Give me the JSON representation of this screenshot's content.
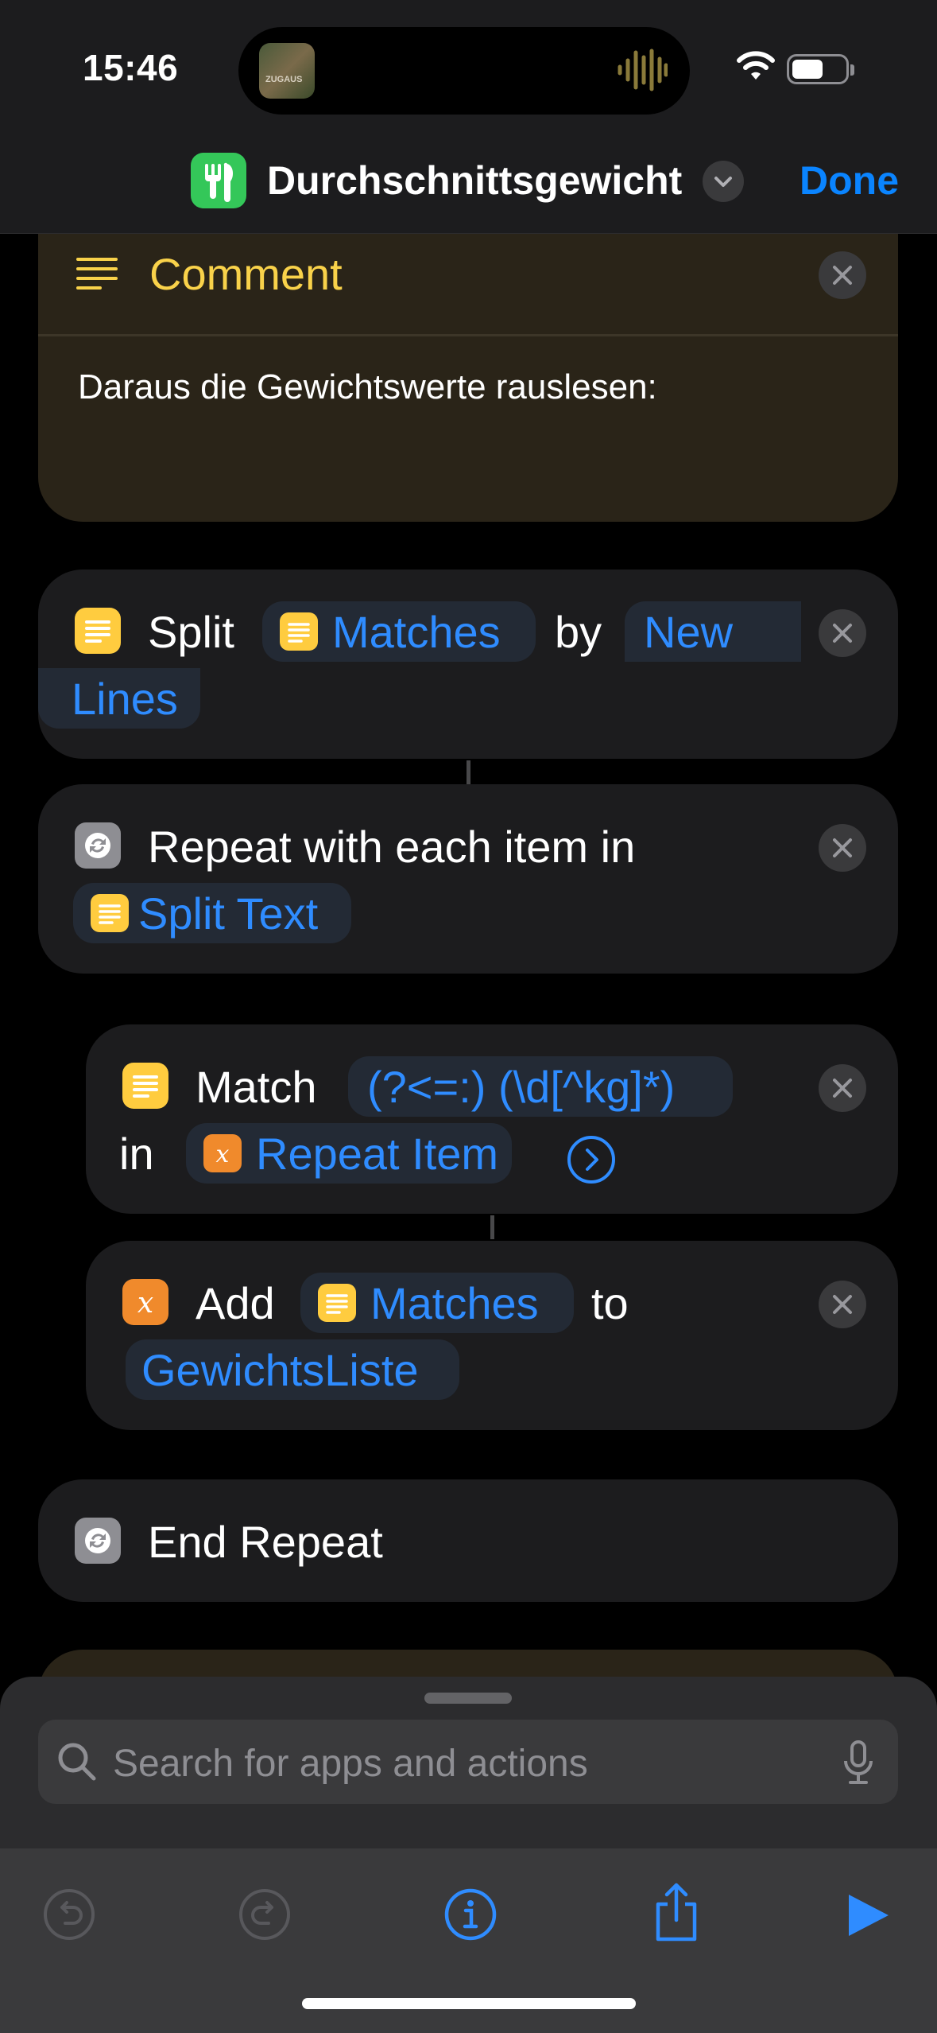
{
  "status_bar": {
    "time": "15:46",
    "island_thumb_caption": "ZUGAUS"
  },
  "nav": {
    "title": "Durchschnittsgewicht",
    "done_label": "Done"
  },
  "comment": {
    "title": "Comment",
    "text": "Daraus die Gewichtswerte rauslesen:"
  },
  "split": {
    "verb": "Split",
    "input_token": "Matches",
    "by_word": "by",
    "separator_line1": "New",
    "separator_line2": "Lines"
  },
  "repeat": {
    "label": "Repeat with each item in",
    "token": "Split Text"
  },
  "match": {
    "verb": "Match",
    "pattern": "(?<=:) (\\d[^kg]*)",
    "in_word": "in",
    "token": "Repeat Item"
  },
  "add": {
    "verb": "Add",
    "token": "Matches",
    "to_word": "to",
    "variable": "GewichtsListe"
  },
  "end_repeat": {
    "label": "End Repeat"
  },
  "search": {
    "placeholder": "Search for apps and actions"
  },
  "colors": {
    "accent": "#2f8cff",
    "comment_title": "#f9d24a",
    "app_icon": "#34c759",
    "text_icon": "#ffcc3f",
    "variable_icon": "#f08a2c"
  }
}
